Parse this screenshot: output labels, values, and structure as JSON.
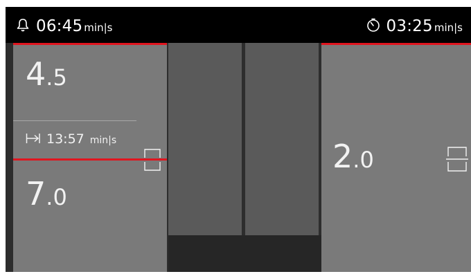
{
  "topbar": {
    "left": {
      "icon": "bell-icon",
      "value": "06:45",
      "unit": "min|s"
    },
    "right": {
      "icon": "timer-icon",
      "value": "03:25",
      "unit": "min|s"
    }
  },
  "left_panel": {
    "top_value": {
      "integer": "4",
      "decimal": ".5"
    },
    "interval": {
      "icon": "interval-icon",
      "value": "13:57",
      "unit": "min|s"
    },
    "bottom_value": {
      "integer": "7",
      "decimal": ".0"
    },
    "handle_icon": "split-handle-icon"
  },
  "right_panel": {
    "value": {
      "integer": "2",
      "decimal": ".0"
    },
    "handle_icon": "split-handle-icon"
  },
  "colors": {
    "accent_red": "#e1151f",
    "panel_gray": "#7a7a7a",
    "bar_gray": "#5a5a5a",
    "background": "#2d2d2d",
    "topbar": "#000000"
  }
}
